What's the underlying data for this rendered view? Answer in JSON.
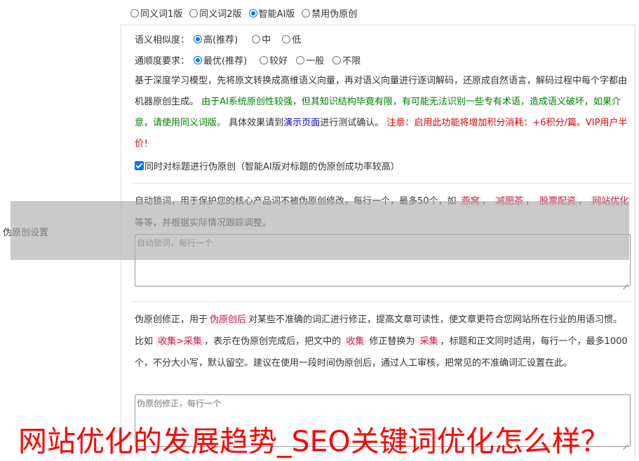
{
  "version_options": [
    {
      "label": "同义词1版",
      "checked": false
    },
    {
      "label": "同义词2版",
      "checked": false
    },
    {
      "label": "智能AI版",
      "checked": true
    },
    {
      "label": "禁用伪原创",
      "checked": false
    }
  ],
  "side_label": "伪原创设置",
  "similarity": {
    "label": "语义相似度：",
    "options": [
      {
        "label": "高(推荐)",
        "checked": true
      },
      {
        "label": "中",
        "checked": false
      },
      {
        "label": "低",
        "checked": false
      }
    ]
  },
  "fluency": {
    "label": "通顺度要求：",
    "options": [
      {
        "label": "最优(推荐)",
        "checked": true
      },
      {
        "label": "较好",
        "checked": false
      },
      {
        "label": "一般",
        "checked": false
      },
      {
        "label": "不限",
        "checked": false
      }
    ]
  },
  "description": {
    "intro": "基于深度学习模型，先将原文转换成高维语义向量，再对语义向量进行逐词解码，还原成自然语言，解码过程中每个字都由机器原创生成。",
    "green_warning": "由于AI系统原创性较强，但其知识结构毕竟有限，有可能无法识别一些专有术语，造成语义破坏，如果介意，请使用同义词版。",
    "test_prefix": "具体效果请到",
    "test_link": "演示页面",
    "test_suffix": "进行测试确认。",
    "red_warning": "注意：启用此功能将增加积分消耗：+6积分/篇。VIP用户半价！"
  },
  "title_checkbox": {
    "label": "同时对标题进行伪原创（智能AI版对标题的伪原创成功率较高）",
    "checked": true
  },
  "lock_words": {
    "desc_prefix": "自动锁词，用于保护您的核心产品词不被伪原创修改，每行一个，最多50个，如",
    "examples": [
      "燕窝",
      "减肥茶",
      "股票配资",
      "网站优化"
    ],
    "separator": "，",
    "desc_suffix": "等等，并根据实际情况跟踪调整。",
    "placeholder": "自动锁词，每行一个"
  },
  "corrections": {
    "p1": "伪原创修正，用于",
    "tag1": "伪原创后",
    "p2": "对某些不准确的词汇进行修正，提高文章可读性，使文章更符合您网站所在行业的用语习惯。比如",
    "tag2": "收集>采集",
    "p3": "，表示在伪原创完成后，把文中的",
    "tag3": "收集",
    "p4": "修正替换为",
    "tag4": "采集",
    "p5": "，标题和正文同时适用，每行一个，最多1000个，不分大小写，默认留空。建议在使用一段时间伪原创后，通过人工审核，把常见的不准确词汇设置在此。",
    "placeholder": "伪原创修正，每行一个"
  },
  "watermark": "网站优化的发展趋势_SEO关键词优化怎么样？"
}
